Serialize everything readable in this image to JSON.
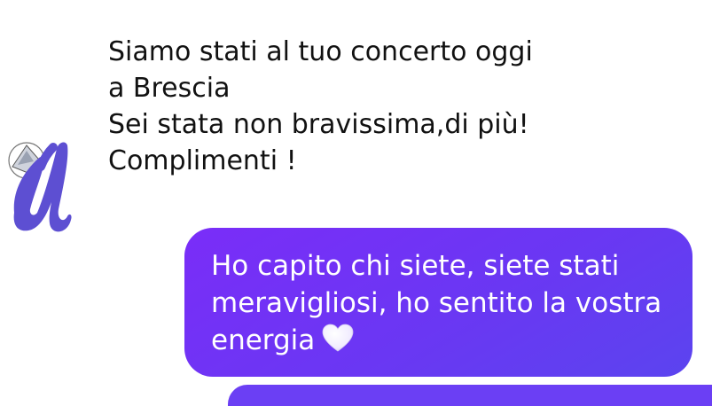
{
  "conversation": {
    "incoming_message": {
      "lines": [
        "Siamo stati al tuo concerto oggi",
        "a Brescia",
        "Sei stata non bravissima,di più!",
        "Complimenti !"
      ]
    },
    "outgoing_message": {
      "lines": [
        "Ho capito chi siete, siete stati",
        "meravigliosi, ho sentito la vostra",
        "energia"
      ],
      "emoji": "white-heart-icon"
    }
  },
  "colors": {
    "outgoing_bubble": "#6a37f3",
    "incoming_text": "#111111",
    "avatar_scribble": "#5d4fd2",
    "background": "#ffffff"
  }
}
